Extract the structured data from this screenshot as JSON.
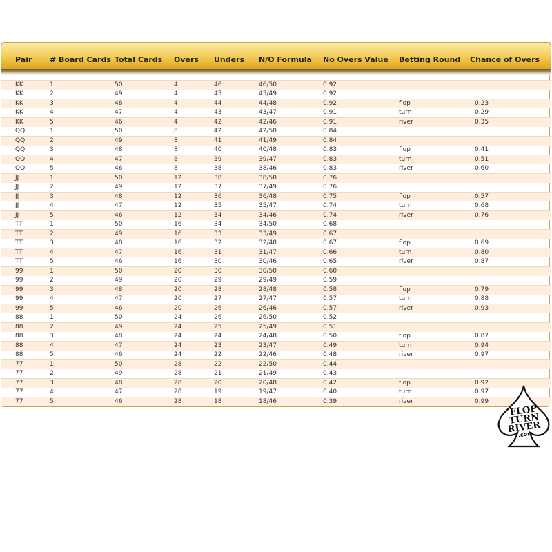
{
  "table": {
    "columns": [
      "Pair",
      "# Board Cards",
      "Total Cards",
      "Overs",
      "Unders",
      "N/O Formula",
      "No Overs Value",
      "Betting Round",
      "Chance of Overs"
    ],
    "rows": [
      [
        "KK",
        "1",
        "50",
        "4",
        "46",
        "46/50",
        "0.92",
        "",
        ""
      ],
      [
        "KK",
        "2",
        "49",
        "4",
        "45",
        "45/49",
        "0.92",
        "",
        ""
      ],
      [
        "KK",
        "3",
        "48",
        "4",
        "44",
        "44/48",
        "0.92",
        "flop",
        "0.23"
      ],
      [
        "KK",
        "4",
        "47",
        "4",
        "43",
        "43/47",
        "0.91",
        "turn",
        "0.29"
      ],
      [
        "KK",
        "5",
        "46",
        "4",
        "42",
        "42/46",
        "0.91",
        "river",
        "0.35"
      ],
      [
        "QQ",
        "1",
        "50",
        "8",
        "42",
        "42/50",
        "0.84",
        "",
        ""
      ],
      [
        "QQ",
        "2",
        "49",
        "8",
        "41",
        "41/49",
        "0.84",
        "",
        ""
      ],
      [
        "QQ",
        "3",
        "48",
        "8",
        "40",
        "40/48",
        "0.83",
        "flop",
        "0.41"
      ],
      [
        "QQ",
        "4",
        "47",
        "8",
        "39",
        "39/47",
        "0.83",
        "turn",
        "0.51"
      ],
      [
        "QQ",
        "5",
        "46",
        "8",
        "38",
        "38/46",
        "0.83",
        "river",
        "0.60"
      ],
      [
        "JJ",
        "1",
        "50",
        "12",
        "38",
        "38/50",
        "0.76",
        "",
        ""
      ],
      [
        "JJ",
        "2",
        "49",
        "12",
        "37",
        "37/49",
        "0.76",
        "",
        ""
      ],
      [
        "JJ",
        "3",
        "48",
        "12",
        "36",
        "36/48",
        "0.75",
        "flop",
        "0.57"
      ],
      [
        "JJ",
        "4",
        "47",
        "12",
        "35",
        "35/47",
        "0.74",
        "turn",
        "0.68"
      ],
      [
        "JJ",
        "5",
        "46",
        "12",
        "34",
        "34/46",
        "0.74",
        "river",
        "0.76"
      ],
      [
        "TT",
        "1",
        "50",
        "16",
        "34",
        "34/50",
        "0.68",
        "",
        ""
      ],
      [
        "TT",
        "2",
        "49",
        "16",
        "33",
        "33/49",
        "0.67",
        "",
        ""
      ],
      [
        "TT",
        "3",
        "48",
        "16",
        "32",
        "32/48",
        "0.67",
        "flop",
        "0.69"
      ],
      [
        "TT",
        "4",
        "47",
        "16",
        "31",
        "31/47",
        "0.66",
        "turn",
        "0.80"
      ],
      [
        "TT",
        "5",
        "46",
        "16",
        "30",
        "30/46",
        "0.65",
        "river",
        "0.87"
      ],
      [
        "99",
        "1",
        "50",
        "20",
        "30",
        "30/50",
        "0.60",
        "",
        ""
      ],
      [
        "99",
        "2",
        "49",
        "20",
        "29",
        "29/49",
        "0.59",
        "",
        ""
      ],
      [
        "99",
        "3",
        "48",
        "20",
        "28",
        "28/48",
        "0.58",
        "flop",
        "0.79"
      ],
      [
        "99",
        "4",
        "47",
        "20",
        "27",
        "27/47",
        "0.57",
        "turn",
        "0.88"
      ],
      [
        "99",
        "5",
        "46",
        "20",
        "26",
        "26/46",
        "0.57",
        "river",
        "0.93"
      ],
      [
        "88",
        "1",
        "50",
        "24",
        "26",
        "26/50",
        "0.52",
        "",
        ""
      ],
      [
        "88",
        "2",
        "49",
        "24",
        "25",
        "25/49",
        "0.51",
        "",
        ""
      ],
      [
        "88",
        "3",
        "48",
        "24",
        "24",
        "24/48",
        "0.50",
        "flop",
        "0.87"
      ],
      [
        "88",
        "4",
        "47",
        "24",
        "23",
        "23/47",
        "0.49",
        "turn",
        "0.94"
      ],
      [
        "88",
        "5",
        "46",
        "24",
        "22",
        "22/46",
        "0.48",
        "river",
        "0.97"
      ],
      [
        "77",
        "1",
        "50",
        "28",
        "22",
        "22/50",
        "0.44",
        "",
        ""
      ],
      [
        "77",
        "2",
        "49",
        "28",
        "21",
        "21/49",
        "0.43",
        "",
        ""
      ],
      [
        "77",
        "3",
        "48",
        "28",
        "20",
        "20/48",
        "0.42",
        "flop",
        "0.92"
      ],
      [
        "77",
        "4",
        "47",
        "28",
        "19",
        "19/47",
        "0.40",
        "turn",
        "0.97"
      ],
      [
        "77",
        "5",
        "46",
        "28",
        "18",
        "18/46",
        "0.39",
        "river",
        "0.99"
      ]
    ]
  },
  "logo": {
    "line1": "FLOP",
    "line2": "TURN",
    "line3": "RIVER",
    "line4": ".com",
    "icon": "spade-icon"
  },
  "colors": {
    "header_gradient_top": "#fbe9a8",
    "header_gradient_bottom": "#d8a024",
    "row_shade": "#fdeedd",
    "border": "#c9a45a"
  }
}
